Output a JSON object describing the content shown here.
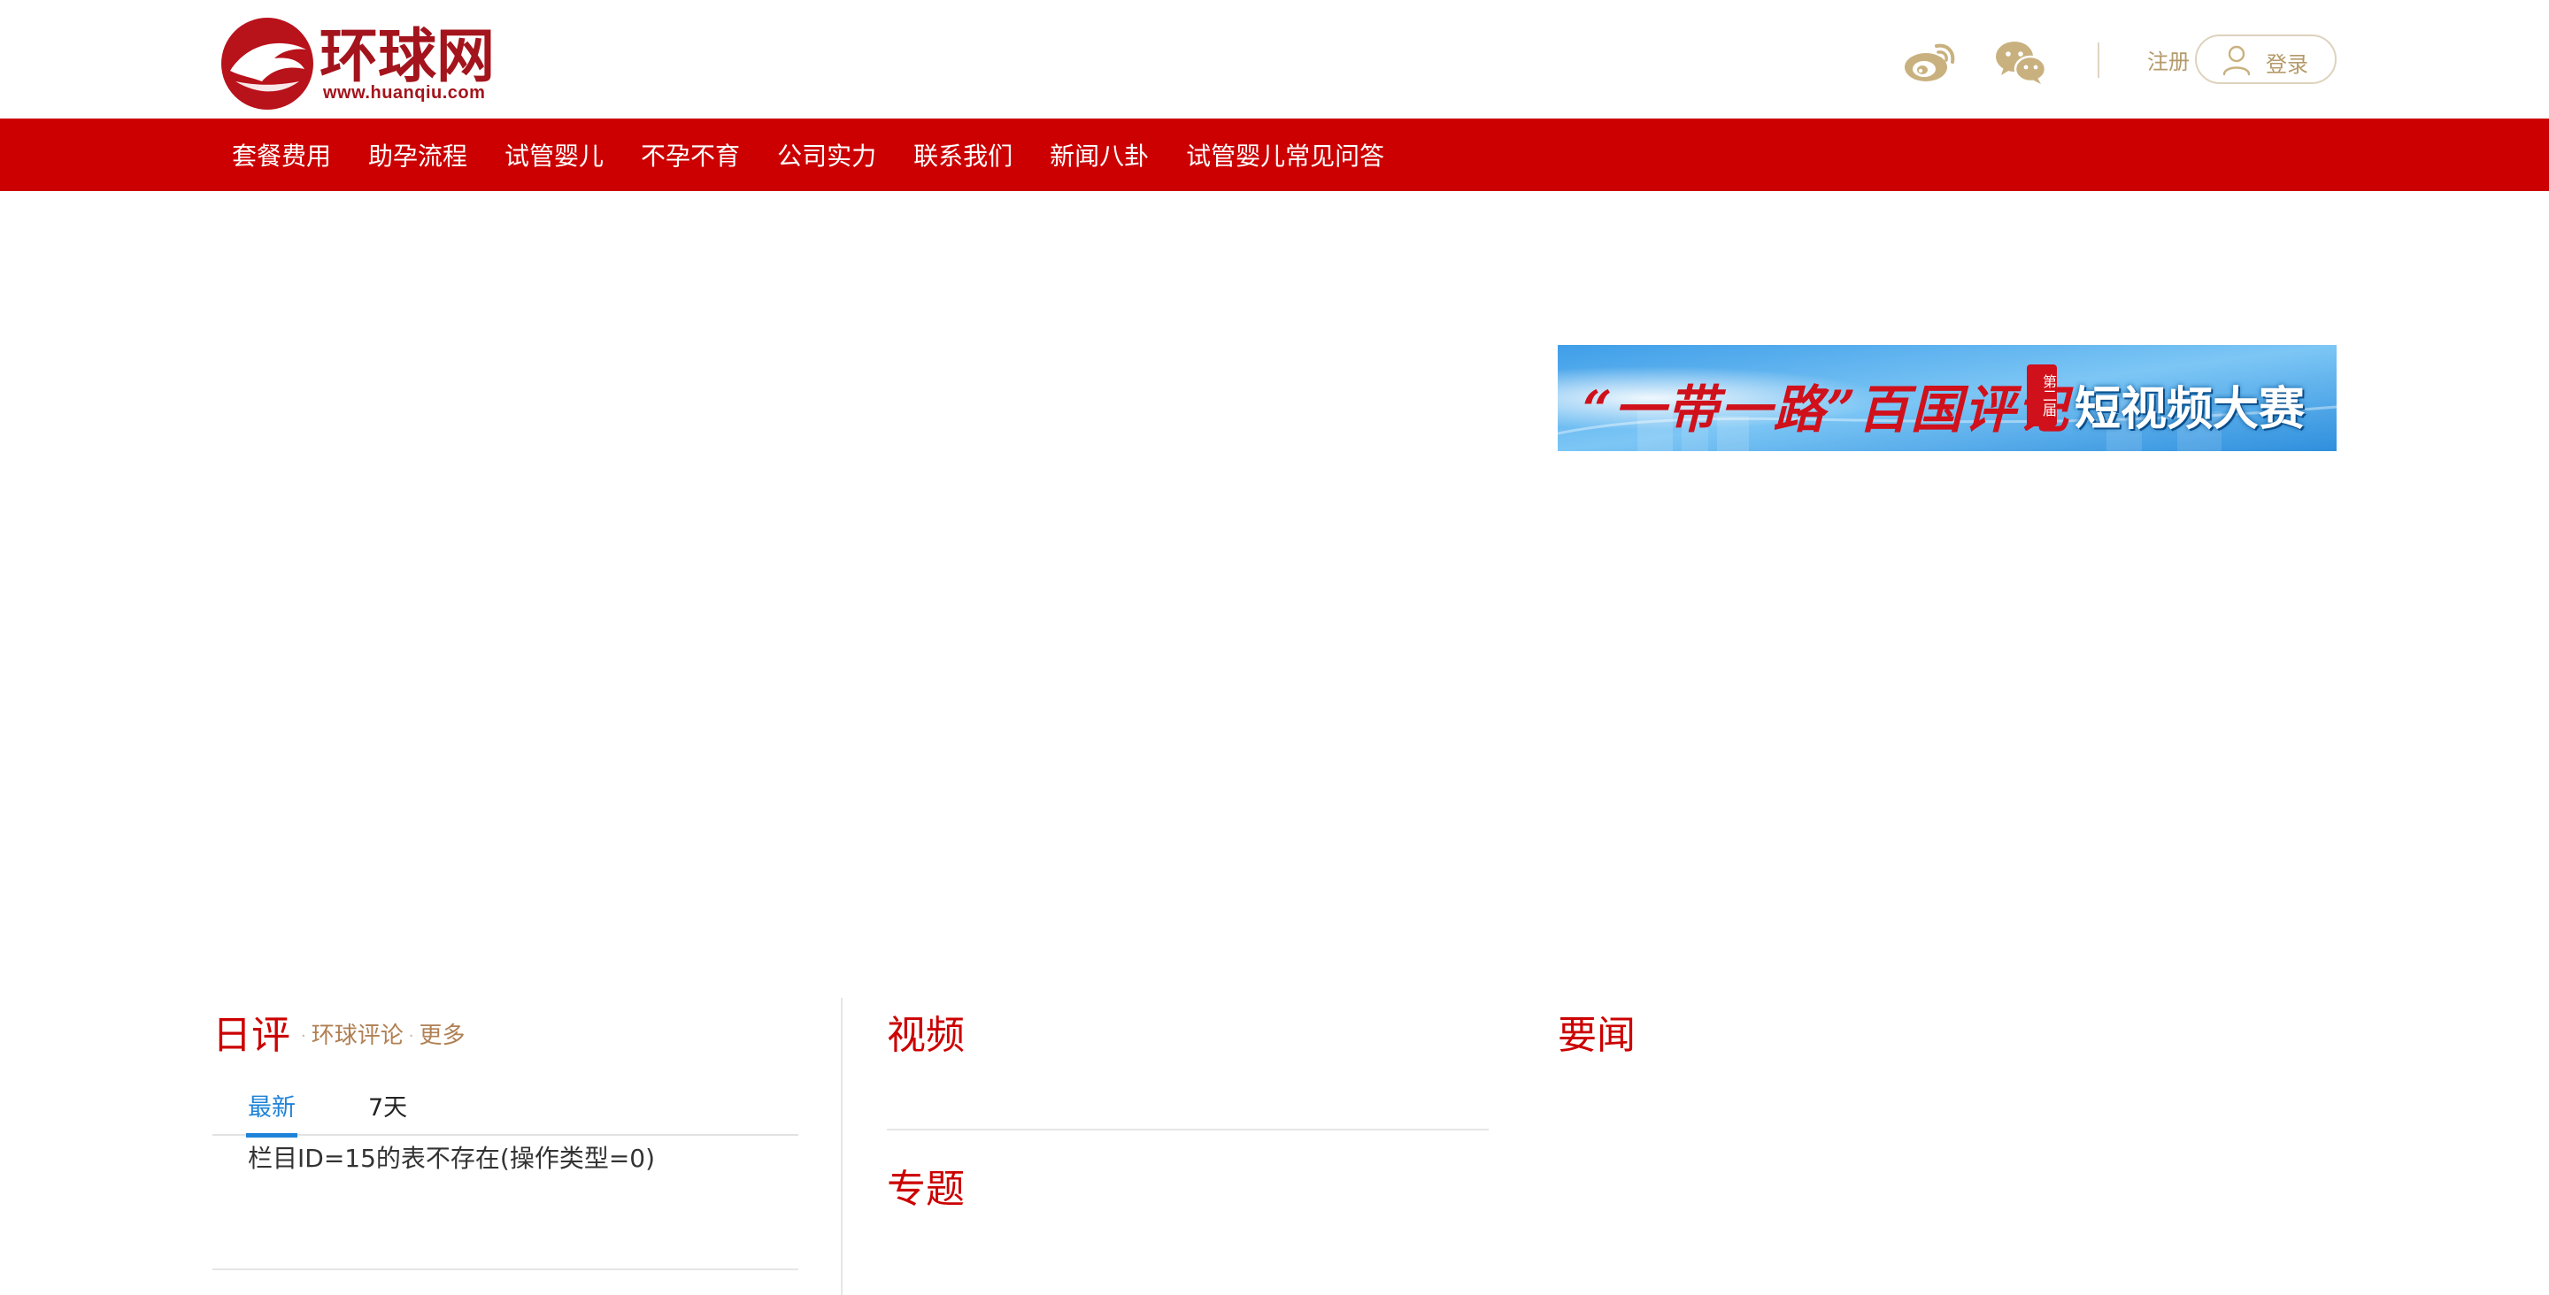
{
  "header": {
    "logo_text": "环球网",
    "logo_url": "www.huanqiu.com",
    "register_label": "注册",
    "login_label": "登录"
  },
  "nav": {
    "items": [
      "套餐费用",
      "助孕流程",
      "试管婴儿",
      "不孕不育",
      "公司实力",
      "联系我们",
      "新闻八卦",
      "试管婴儿常见问答"
    ]
  },
  "banner": {
    "title": "“一带一路”百国评记",
    "badge": "第二届",
    "subtitle": "短视频大赛"
  },
  "commentary": {
    "title": "日评",
    "link1": "环球评论",
    "link2": "更多",
    "tabs": [
      "最新",
      "7天"
    ],
    "message": "栏目ID=15的表不存在(操作类型=0)"
  },
  "video": {
    "title": "视频"
  },
  "topic": {
    "title": "专题"
  },
  "news": {
    "title": "要闻"
  },
  "colors": {
    "brand_red": "#cc0000",
    "gold": "#b49a6a",
    "tab_blue": "#1e83d8"
  }
}
